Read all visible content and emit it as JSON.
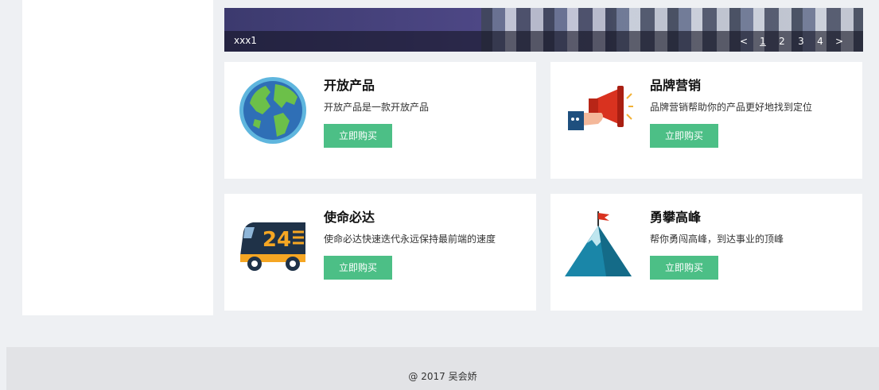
{
  "banner": {
    "caption": "xxx1",
    "pager": {
      "prev": "<",
      "pages": [
        "1",
        "2",
        "3",
        "4"
      ],
      "next": ">"
    }
  },
  "cards": [
    {
      "title": "开放产品",
      "desc": "开放产品是一款开放产品",
      "button": "立即购买",
      "icon": "globe-icon"
    },
    {
      "title": "品牌营销",
      "desc": "品牌营销帮助你的产品更好地找到定位",
      "button": "立即购买",
      "icon": "megaphone-icon"
    },
    {
      "title": "使命必达",
      "desc": "使命必达快速迭代永远保持最前端的速度",
      "button": "立即购买",
      "icon": "delivery-truck-icon"
    },
    {
      "title": "勇攀高峰",
      "desc": "帮你勇闯高峰，到达事业的顶峰",
      "button": "立即购买",
      "icon": "mountain-flag-icon"
    }
  ],
  "truck_badge": "24",
  "footer": {
    "copyright": "@ 2017 吴会娇"
  },
  "colors": {
    "accent": "#4cbf86",
    "background": "#eef0f3"
  }
}
